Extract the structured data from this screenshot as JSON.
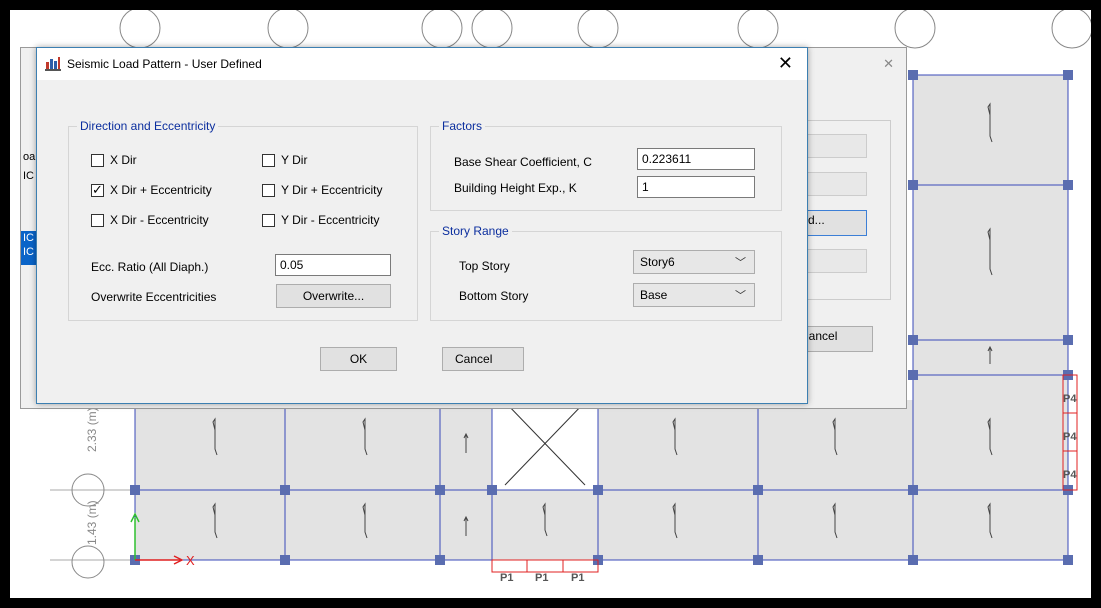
{
  "dialog": {
    "title": "Seismic Load Pattern - User Defined",
    "close_glyph": "✕",
    "direction_group": {
      "title": "Direction and Eccentricity",
      "checkboxes": [
        {
          "label": "X Dir",
          "checked": false
        },
        {
          "label": "Y Dir",
          "checked": false
        },
        {
          "label": "X Dir + Eccentricity",
          "checked": true
        },
        {
          "label": "Y Dir + Eccentricity",
          "checked": false
        },
        {
          "label": "X Dir - Eccentricity",
          "checked": false
        },
        {
          "label": "Y Dir - Eccentricity",
          "checked": false
        }
      ],
      "ecc_ratio_label": "Ecc. Ratio (All Diaph.)",
      "ecc_ratio_value": "0.05",
      "overwrite_label": "Overwrite Eccentricities",
      "overwrite_button": "Overwrite..."
    },
    "factors_group": {
      "title": "Factors",
      "base_shear_label": "Base Shear Coefficient, C",
      "base_shear_value": "0.223611",
      "height_exp_label": "Building Height Exp., K",
      "height_exp_value": "1"
    },
    "story_group": {
      "title": "Story Range",
      "top_label": "Top Story",
      "top_value": "Story6",
      "bottom_label": "Bottom Story",
      "bottom_value": "Base"
    },
    "ok_button": "OK",
    "cancel_button": "Cancel"
  },
  "background_dialog": {
    "close_glyph": "✕",
    "partial_button": "d...",
    "cancel_button": "Cancel",
    "clipped_texts": [
      "oa",
      "IC",
      "IC",
      "IC"
    ]
  },
  "plan": {
    "axis_x_label": "X",
    "dim_upper": "2.33 (m)",
    "dim_lower": "1.43 (m)",
    "pier_labels_bottom": [
      "P1",
      "P1",
      "P1"
    ],
    "pier_labels_right": [
      "P4",
      "P4",
      "P4"
    ]
  },
  "colors": {
    "grid_line": "#3a4ab8",
    "joint": "#5a6db0",
    "slab_fill": "#e3e3e3",
    "pier": "#e02020",
    "dialog_group_title": "#0b2e9e"
  }
}
